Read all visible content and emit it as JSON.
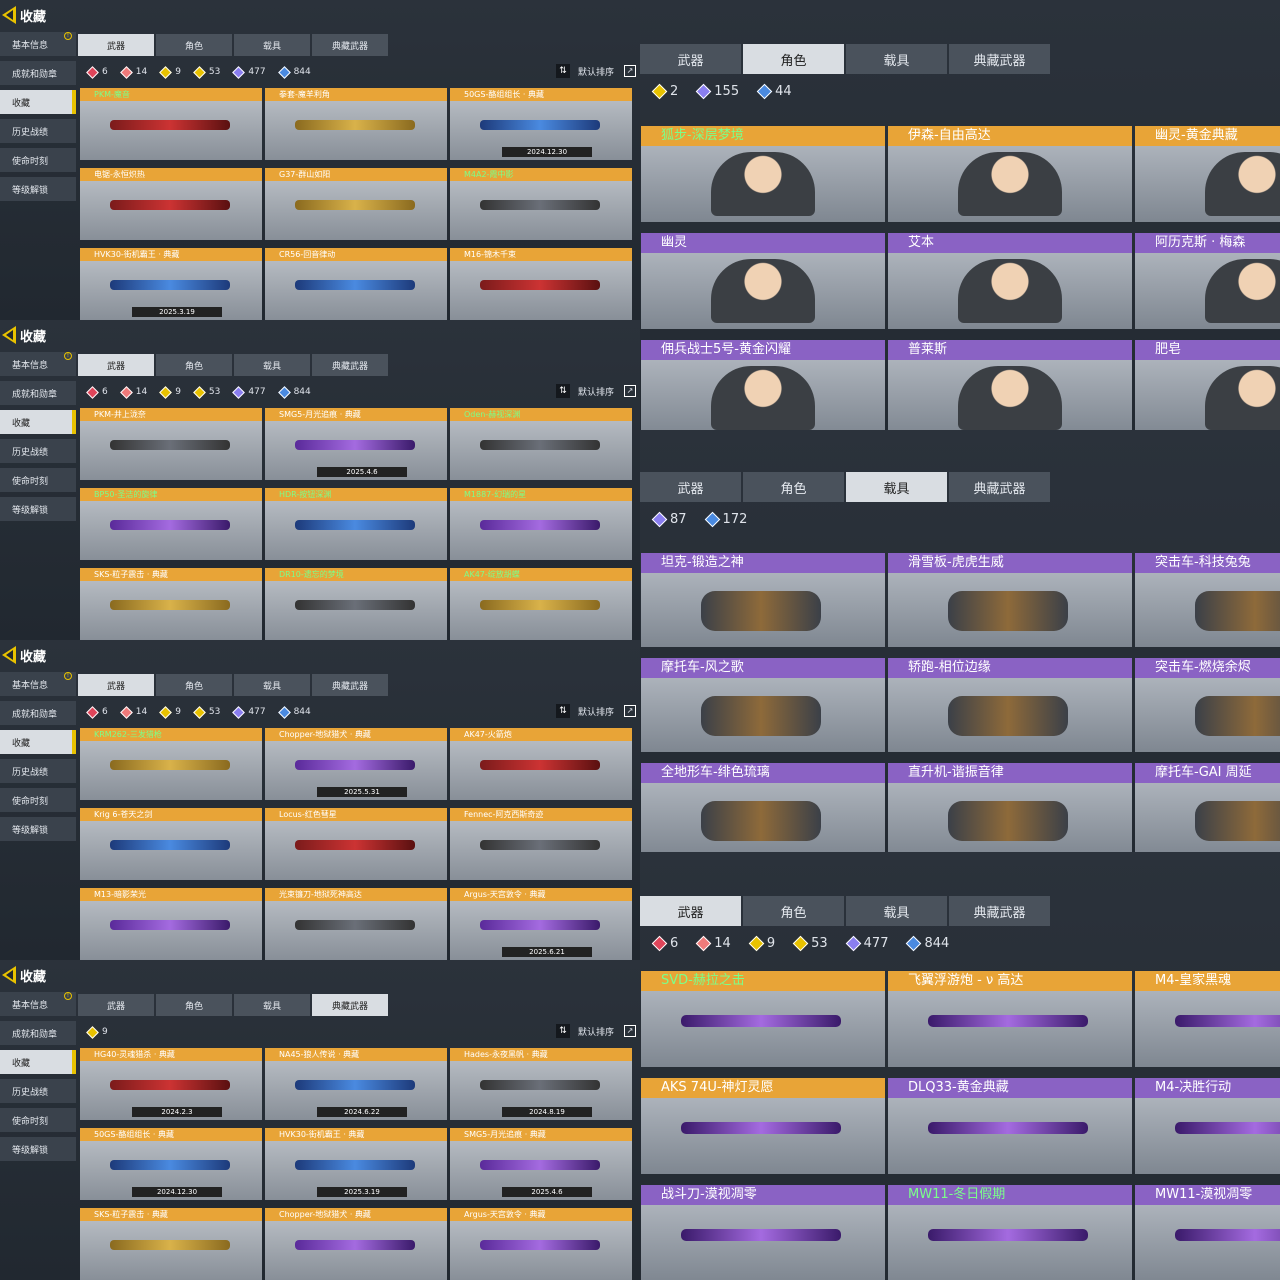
{
  "left_panels": [
    {
      "title": "收藏",
      "nav": [
        "基本信息",
        "成就和勋章",
        "收藏",
        "历史战绩",
        "使命时刻",
        "等级解锁"
      ],
      "tabs": [
        "武器",
        "角色",
        "载具",
        "典藏武器"
      ],
      "active_tab": 0,
      "counts": [
        {
          "v": "6",
          "c": "#e0455a"
        },
        {
          "v": "14",
          "c": "#f07a7a"
        },
        {
          "v": "9",
          "c": "#e8c200"
        },
        {
          "v": "53",
          "c": "#e8c200"
        },
        {
          "v": "477",
          "c": "#8a7ef0"
        },
        {
          "v": "844",
          "c": "#4a8ae0"
        }
      ],
      "sort": "默认排序",
      "cards": [
        {
          "n": "PKM-魔音",
          "g": true,
          "w": "red"
        },
        {
          "n": "拳套-魔羊利角",
          "w": "gold"
        },
        {
          "n": "50GS-酪组组长 · 典藏",
          "w": "blu",
          "d": "2024.12.30"
        },
        {
          "n": "电锯-永恒炽热",
          "w": "red"
        },
        {
          "n": "G37-群山如阳",
          "w": "gold"
        },
        {
          "n": "M4A2-霞中影",
          "g": true,
          "w": ""
        },
        {
          "n": "HVK30-街机霸王 · 典藏",
          "w": "blu",
          "d": "2025.3.19"
        },
        {
          "n": "CR56-回音律动",
          "w": "blu"
        },
        {
          "n": "M16-锦木千束",
          "w": "red"
        }
      ]
    },
    {
      "title": "收藏",
      "nav": [
        "基本信息",
        "成就和勋章",
        "收藏",
        "历史战绩",
        "使命时刻",
        "等级解锁"
      ],
      "tabs": [
        "武器",
        "角色",
        "载具",
        "典藏武器"
      ],
      "active_tab": 0,
      "counts": [
        {
          "v": "6",
          "c": "#e0455a"
        },
        {
          "v": "14",
          "c": "#f07a7a"
        },
        {
          "v": "9",
          "c": "#e8c200"
        },
        {
          "v": "53",
          "c": "#e8c200"
        },
        {
          "v": "477",
          "c": "#8a7ef0"
        },
        {
          "v": "844",
          "c": "#4a8ae0"
        }
      ],
      "sort": "默认排序",
      "cards": [
        {
          "n": "PKM-井上泷奈",
          "w": ""
        },
        {
          "n": "SMG5-月光追痕 · 典藏",
          "w": "pur",
          "d": "2025.4.6"
        },
        {
          "n": "Oden-赫视深渊",
          "g": true,
          "w": ""
        },
        {
          "n": "BP50-圣洁的旋律",
          "g": true,
          "w": "pur"
        },
        {
          "n": "HDR-按钮深渊",
          "g": true,
          "w": "blu"
        },
        {
          "n": "M1887-幻瑞的星",
          "g": true,
          "w": "pur"
        },
        {
          "n": "SKS-粒子震击 · 典藏",
          "w": "gold"
        },
        {
          "n": "DR10-遗忘的梦境",
          "g": true,
          "w": ""
        },
        {
          "n": "AK47-绽放胡蝶",
          "g": true,
          "w": "gold"
        }
      ]
    },
    {
      "title": "收藏",
      "nav": [
        "基本信息",
        "成就和勋章",
        "收藏",
        "历史战绩",
        "使命时刻",
        "等级解锁"
      ],
      "tabs": [
        "武器",
        "角色",
        "载具",
        "典藏武器"
      ],
      "active_tab": 0,
      "counts": [
        {
          "v": "6",
          "c": "#e0455a"
        },
        {
          "v": "14",
          "c": "#f07a7a"
        },
        {
          "v": "9",
          "c": "#e8c200"
        },
        {
          "v": "53",
          "c": "#e8c200"
        },
        {
          "v": "477",
          "c": "#8a7ef0"
        },
        {
          "v": "844",
          "c": "#4a8ae0"
        }
      ],
      "sort": "默认排序",
      "cards": [
        {
          "n": "KRM262-三发猎枪",
          "g": true,
          "w": "gold"
        },
        {
          "n": "Chopper-地狱猎犬 · 典藏",
          "w": "pur",
          "d": "2025.5.31"
        },
        {
          "n": "AK47-火箭炮",
          "w": "red"
        },
        {
          "n": "Krig 6-苍天之剑",
          "w": "blu"
        },
        {
          "n": "Locus-红色彗星",
          "w": "red"
        },
        {
          "n": "Fennec-阿克西斯奇迹",
          "w": ""
        },
        {
          "n": "M13-暗影荣光",
          "w": "pur"
        },
        {
          "n": "光束镰刀-地狱死神高达",
          "w": ""
        },
        {
          "n": "Argus-天宫敦令 · 典藏",
          "w": "pur",
          "d": "2025.6.21"
        }
      ]
    },
    {
      "title": "收藏",
      "nav": [
        "基本信息",
        "成就和勋章",
        "收藏",
        "历史战绩",
        "使命时刻",
        "等级解锁"
      ],
      "tabs": [
        "武器",
        "角色",
        "载具",
        "典藏武器"
      ],
      "active_tab": 3,
      "counts": [
        {
          "v": "9",
          "c": "#e8c200"
        }
      ],
      "sort": "默认排序",
      "cards": [
        {
          "n": "HG40-灵魂猎杀 · 典藏",
          "w": "red",
          "d": "2024.2.3"
        },
        {
          "n": "NA45-狼人传说 · 典藏",
          "w": "blu",
          "d": "2024.6.22"
        },
        {
          "n": "Hades-永夜黑帆 · 典藏",
          "w": "",
          "d": "2024.8.19"
        },
        {
          "n": "50GS-酪组组长 · 典藏",
          "w": "blu",
          "d": "2024.12.30"
        },
        {
          "n": "HVK30-街机霸王 · 典藏",
          "w": "blu",
          "d": "2025.3.19"
        },
        {
          "n": "SMG5-月光追痕 · 典藏",
          "w": "pur",
          "d": "2025.4.6"
        },
        {
          "n": "SKS-粒子震击 · 典藏",
          "w": "gold"
        },
        {
          "n": "Chopper-地狱猎犬 · 典藏",
          "w": "pur"
        },
        {
          "n": "Argus-天宫敦令 · 典藏",
          "w": "pur"
        }
      ]
    }
  ],
  "right_panels": [
    {
      "tabs": [
        "武器",
        "角色",
        "载具",
        "典藏武器"
      ],
      "active_tab": 1,
      "counts": [
        {
          "v": "2",
          "c": "#e8c200"
        },
        {
          "v": "155",
          "c": "#8a7ef0"
        },
        {
          "v": "44",
          "c": "#4a8ae0"
        }
      ],
      "kind": "char",
      "cards": [
        {
          "n": "狐步-深层梦境",
          "org": true,
          "g": true
        },
        {
          "n": "伊森-自由高达",
          "org": true
        },
        {
          "n": "幽灵-黄金典藏",
          "org": true
        },
        {
          "n": "幽灵"
        },
        {
          "n": "艾本"
        },
        {
          "n": "阿历克斯 · 梅森"
        },
        {
          "n": "佣兵战士5号-黄金闪耀"
        },
        {
          "n": "普莱斯"
        },
        {
          "n": "肥皂"
        }
      ]
    },
    {
      "tabs": [
        "武器",
        "角色",
        "载具",
        "典藏武器"
      ],
      "active_tab": 2,
      "counts": [
        {
          "v": "87",
          "c": "#8a7ef0"
        },
        {
          "v": "172",
          "c": "#4a8ae0"
        }
      ],
      "kind": "veh",
      "cards": [
        {
          "n": "坦克-锻造之神"
        },
        {
          "n": "滑雪板-虎虎生威"
        },
        {
          "n": "突击车-科技兔兔"
        },
        {
          "n": "摩托车-风之歌"
        },
        {
          "n": "轿跑-相位边缘"
        },
        {
          "n": "突击车-燃烧余烬"
        },
        {
          "n": "全地形车-绯色琉璃"
        },
        {
          "n": "直升机-谐振音律"
        },
        {
          "n": "摩托车-GAI 周延"
        }
      ]
    },
    {
      "tabs": [
        "武器",
        "角色",
        "载具",
        "典藏武器"
      ],
      "active_tab": 0,
      "counts": [
        {
          "v": "6",
          "c": "#e0455a"
        },
        {
          "v": "14",
          "c": "#f07a7a"
        },
        {
          "v": "9",
          "c": "#e8c200"
        },
        {
          "v": "53",
          "c": "#e8c200"
        },
        {
          "v": "477",
          "c": "#8a7ef0"
        },
        {
          "v": "844",
          "c": "#4a8ae0"
        }
      ],
      "kind": "wpn",
      "cards": [
        {
          "n": "SVD-赫拉之击",
          "org": true,
          "g": true
        },
        {
          "n": "飞翼浮游炮 - ν 高达",
          "org": true
        },
        {
          "n": "M4-皇家黑魂",
          "org": true
        },
        {
          "n": "AKS 74U-神灯灵愿",
          "org": true
        },
        {
          "n": "DLQ33-黄金典藏"
        },
        {
          "n": "M4-决胜行动"
        },
        {
          "n": "战斗刀-漠视凋零"
        },
        {
          "n": "MW11-冬日假期",
          "g": true
        },
        {
          "n": "MW11-漠视凋零"
        }
      ]
    }
  ]
}
